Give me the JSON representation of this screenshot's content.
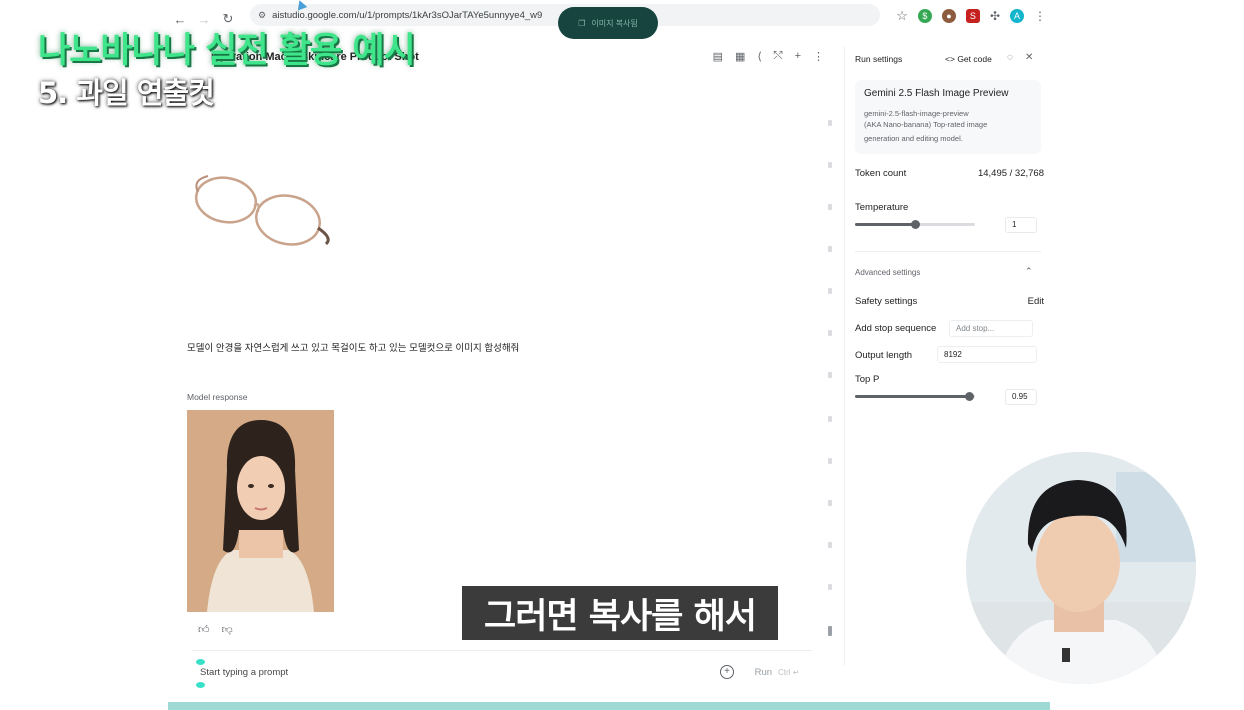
{
  "browser": {
    "url": "aistudio.google.com/u/1/prompts/1kAr3sOJarTAYe5unnyye4_w9",
    "toast_text": "이미지 복사됨"
  },
  "header": {
    "prompt_title": "Hydration Macro Skincare Product Shot"
  },
  "chat": {
    "user_prompt": "모델이 안경을 자연스럽게 쓰고 있고 목걸이도 하고 있는 모델컷으로 이미지 합성해줘",
    "model_response_label": "Model response",
    "input_placeholder": "Start typing a prompt",
    "run_label": "Run",
    "run_shortcut": "Ctrl ↵"
  },
  "settings": {
    "title": "Run settings",
    "get_code": "Get code",
    "model_name": "Gemini 2.5 Flash Image Preview",
    "model_id": "gemini-2.5-flash-image-preview",
    "model_description_1": "(AKA Nano-banana) Top-rated image",
    "model_description_2": "generation and editing model.",
    "token_label": "Token count",
    "token_value": "14,495 / 32,768",
    "temperature_label": "Temperature",
    "temperature_value": "1",
    "temperature_fraction": 0.5,
    "advanced_label": "Advanced settings",
    "safety_label": "Safety settings",
    "safety_edit": "Edit",
    "stop_label": "Add stop sequence",
    "stop_placeholder": "Add stop...",
    "output_label": "Output length",
    "output_value": "8192",
    "top_p_label": "Top P",
    "top_p_value": "0.95"
  },
  "overlay": {
    "title": "나노바나나 실전 활용 예시",
    "subtitle": "5. 과일 연출컷",
    "caption": "그러면 복사를 해서"
  },
  "colors": {
    "title_green": "#3ee58a",
    "toast_bg": "#0c3b36",
    "caption_bg": "#3b3b3b"
  }
}
